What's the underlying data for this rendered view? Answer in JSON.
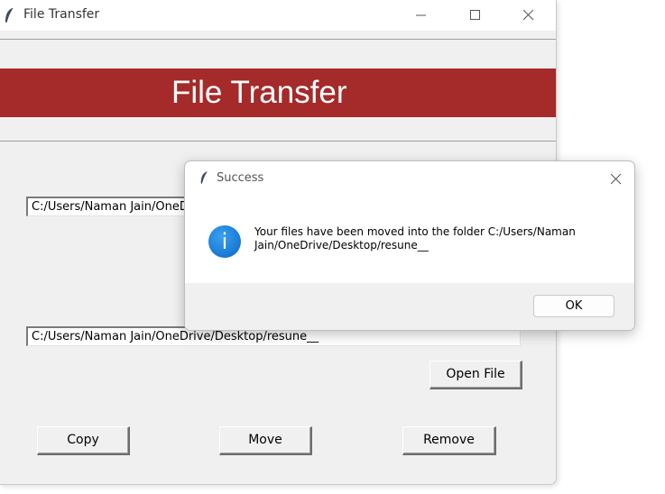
{
  "window": {
    "title": "File Transfer",
    "header_title": "File Transfer",
    "source_path": "C:/Users/Naman Jain/OneDrive/Desktop",
    "destination_path": "C:/Users/Naman Jain/OneDrive/Desktop/resune__",
    "buttons": {
      "open_file": "Open File",
      "copy": "Copy",
      "move": "Move",
      "remove": "Remove"
    }
  },
  "dialog": {
    "title": "Success",
    "message": "Your files have been moved into the folder C:/Users/Naman Jain/OneDrive/Desktop/resune__",
    "ok_label": "OK",
    "icon": "info-icon"
  },
  "colors": {
    "header_band": "#a52a2a",
    "window_bg": "#f0f0f0",
    "info_icon": "#1a7fd8"
  }
}
